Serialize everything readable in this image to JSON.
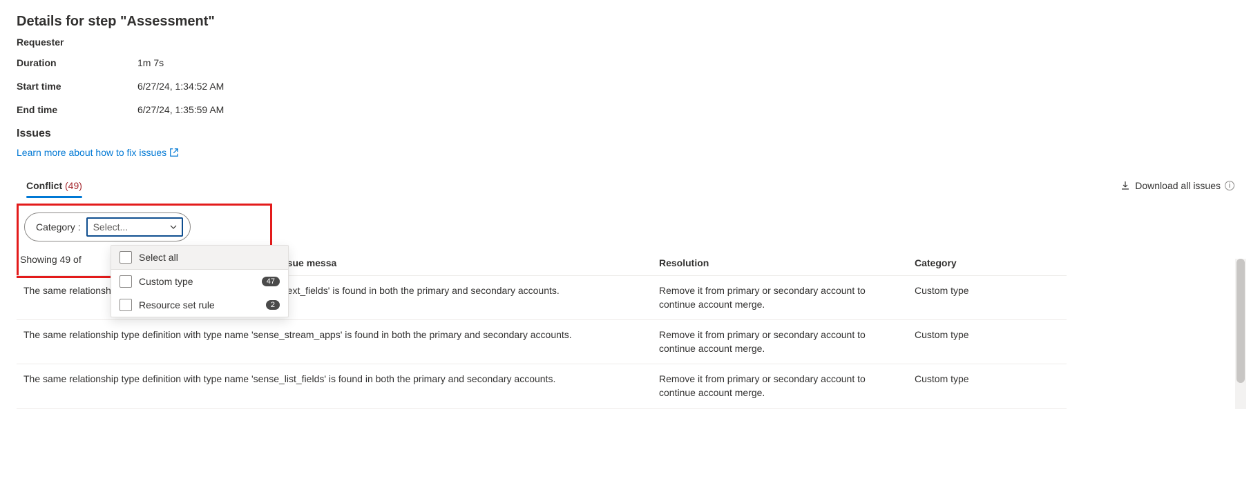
{
  "header": {
    "title": "Details for step \"Assessment\"",
    "requester_label": "Requester"
  },
  "details": {
    "duration_label": "Duration",
    "duration_value": "1m 7s",
    "start_label": "Start time",
    "start_value": "6/27/24, 1:34:52 AM",
    "end_label": "End time",
    "end_value": "6/27/24, 1:35:59 AM"
  },
  "issues": {
    "heading": "Issues",
    "learn_more": "Learn more about how to fix issues"
  },
  "tabs": {
    "conflict_label": "Conflict",
    "conflict_count": "(49)"
  },
  "toolbar": {
    "download_label": "Download all issues"
  },
  "filter": {
    "label": "Category :",
    "placeholder": "Select...",
    "showing": "Showing 49 of",
    "options": {
      "select_all": "Select all",
      "custom_type": "Custom type",
      "custom_type_count": "47",
      "resource_set_rule": "Resource set rule",
      "resource_set_rule_count": "2"
    }
  },
  "table": {
    "headers": {
      "message": "Issue messa",
      "resolution": "Resolution",
      "category": "Category"
    },
    "rows": [
      {
        "message": "The same relationship type definition with type name 'sense_text_fields' is found in both the primary and secondary accounts.",
        "resolution": "Remove it from primary or secondary account to continue account merge.",
        "category": "Custom type"
      },
      {
        "message": "The same relationship type definition with type name 'sense_stream_apps' is found in both the primary and secondary accounts.",
        "resolution": "Remove it from primary or secondary account to continue account merge.",
        "category": "Custom type"
      },
      {
        "message": "The same relationship type definition with type name 'sense_list_fields' is found in both the primary and secondary accounts.",
        "resolution": "Remove it from primary or secondary account to continue account merge.",
        "category": "Custom type"
      }
    ]
  }
}
